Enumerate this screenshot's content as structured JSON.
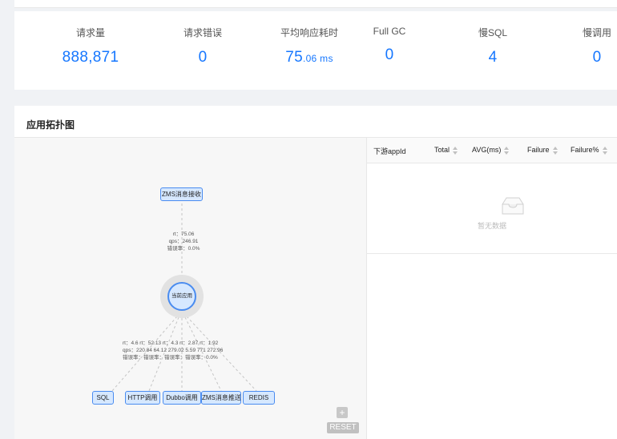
{
  "metrics": [
    {
      "label": "请求量",
      "value": "888,871",
      "unit": ""
    },
    {
      "label": "请求错误",
      "value": "0",
      "unit": ""
    },
    {
      "label": "平均响应耗时",
      "value": "75",
      "unit": ".06 ms"
    },
    {
      "label": "Full GC",
      "value": "0",
      "unit": ""
    },
    {
      "label": "慢SQL",
      "value": "4",
      "unit": ""
    },
    {
      "label": "慢调用",
      "value": "0",
      "unit": ""
    }
  ],
  "topology": {
    "title": "应用拓扑图",
    "upstream": {
      "label": "ZMS消息接收",
      "rt": "rt：75.06",
      "qps": "qps：246.91",
      "err": "错误率：0.0%"
    },
    "center": {
      "label": "当前应用"
    },
    "downstream": [
      {
        "label": "SQL"
      },
      {
        "label": "HTTP调用"
      },
      {
        "label": "Dubbo调用"
      },
      {
        "label": "ZMS消息推送"
      },
      {
        "label": "REDIS"
      }
    ],
    "downstream_labels": {
      "line1": "rt：4.6 rt：52.13 rt：4.3 rt：2.87 rt：1.92",
      "line2": "qps：220.84 64.12 279.02 5.59 771 272.96",
      "line3": "错误率：错误率：错误率：错误率：0.0%"
    },
    "controls": {
      "plus": "+",
      "reset": "RESET"
    }
  },
  "table": {
    "columns": [
      "下游appId",
      "Total",
      "AVG(ms)",
      "Failure",
      "Failure%"
    ],
    "empty_text": "暂无数据"
  },
  "colors": {
    "accent": "#1677ff",
    "node_fill": "#d6e8ff",
    "node_border": "#4a8cf0"
  }
}
